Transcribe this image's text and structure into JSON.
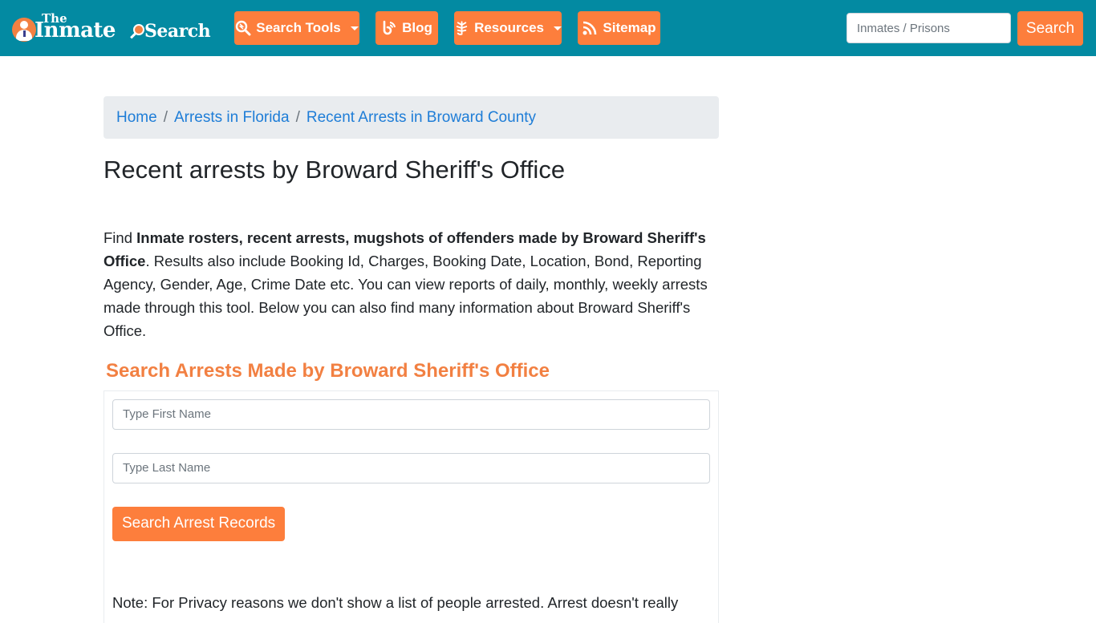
{
  "brand": {
    "logo_top": "The",
    "logo_main": "Inmate",
    "logo_end": "Search"
  },
  "nav": {
    "items": [
      {
        "label": "Search Tools",
        "icon": "search-tools-icon",
        "dropdown": true
      },
      {
        "label": "Blog",
        "icon": "blog-icon",
        "dropdown": false
      },
      {
        "label": "Resources",
        "icon": "leaf-icon",
        "dropdown": true
      },
      {
        "label": "Sitemap",
        "icon": "rss-icon",
        "dropdown": false
      }
    ],
    "search_placeholder": "Inmates / Prisons",
    "search_value": "",
    "search_button": "Search"
  },
  "breadcrumb": {
    "items": [
      "Home",
      "Arrests in Florida",
      "Recent Arrests in Broward County"
    ],
    "separator": "/"
  },
  "page": {
    "title": "Recent arrests by Broward Sheriff's Office",
    "intro_prefix": "Find ",
    "intro_bold": "Inmate rosters, recent arrests, mugshots of offenders made by Broward Sheriff's Office",
    "intro_rest": ". Results also include Booking Id, Charges, Booking Date, Location, Bond, Reporting Agency, Gender, Age, Crime Date etc. You can view reports of daily, monthly, weekly arrests made through this tool. Below you can also find many information about Broward Sheriff's Office."
  },
  "search_form": {
    "title": "Search Arrests Made by Broward Sheriff's Office",
    "first_name_placeholder": "Type First Name",
    "first_name_value": "",
    "last_name_placeholder": "Type Last Name",
    "last_name_value": "",
    "submit_label": "Search Arrest Records",
    "note": "Note: For Privacy reasons we don't show a list of people arrested. Arrest doesn't really"
  },
  "colors": {
    "navbar": "#038aa2",
    "accent": "#fd7e3c",
    "heading_accent": "#f28042",
    "link": "#1e7dd7",
    "breadcrumb_bg": "#e9ecef"
  }
}
